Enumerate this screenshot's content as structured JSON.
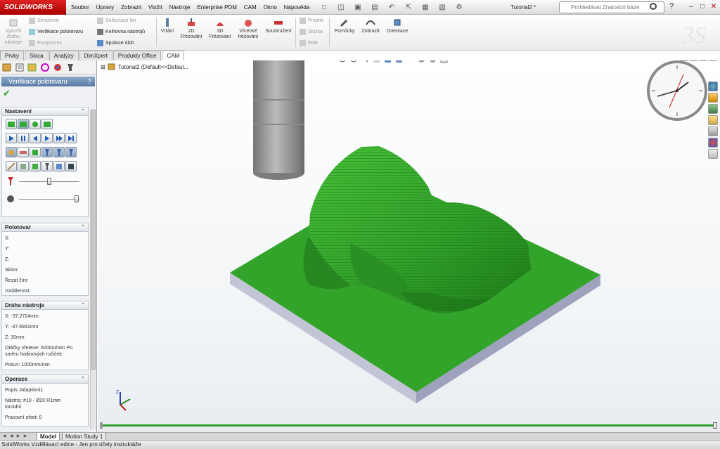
{
  "titlebar": {
    "app_logo": "SOLIDWORKS",
    "menus": [
      "Soubor",
      "Úpravy",
      "Zobrazit",
      "Vložit",
      "Nástroje",
      "Enterprise PDM",
      "CAM",
      "Okno",
      "Nápověda"
    ],
    "document_title": "Tutorial2 *",
    "search_placeholder": "Prohledávat Znalostní báze",
    "help": "?"
  },
  "command_manager": {
    "toolpath_button": "Vytvořit dráhu nástroje",
    "simulate": "Simulovat",
    "verify_stock": "Verifikace polotovaru",
    "postprocess": "Postproces",
    "setup_sheet": "Seřizovací list",
    "tool_library": "Knihovna nástrojů",
    "job_manager": "Správce úloh",
    "drilling": "Vrtání",
    "milling_2d": "2D Frézování",
    "milling_3d": "3D Frézování",
    "multiaxis": "Víceosé frézování",
    "turning": "Soustružení",
    "project": "Projekt",
    "folder": "Složka",
    "field": "Pole",
    "helpers": "Pomůcky",
    "display": "Zobrazit",
    "orientation": "Orientace"
  },
  "tabs": [
    "Prvky",
    "Skica",
    "Analýzy",
    "DimXpert",
    "Produkty Office",
    "CAM"
  ],
  "active_tab": "CAM",
  "property_manager": {
    "title": "Verifikace polotovaru",
    "help": "?",
    "settings": {
      "label": "Nastavení"
    },
    "stock": {
      "label": "Polotovar",
      "rows": [
        "X:",
        "Y:",
        "Z:",
        "Sklon:",
        "Řezat čím:",
        "Vzdálenost:"
      ]
    },
    "toolpath": {
      "label": "Dráha nástroje",
      "x": "X: -37.2724mm",
      "y": "Y: -37.6931mm",
      "z": "Z: 10mm",
      "spindle_1": "Otáčky vřetene: 5000ot/min Po",
      "spindle_2": "směru hodinových ručiček",
      "feed": "Posuv: 1000mm/min"
    },
    "operation": {
      "label": "Operace",
      "description": "Popis: Adaptivní1",
      "tool_1": "Nástroj: #10 - Ø20 R1mm",
      "tool_2": "toroidní",
      "work_offset": "Pracovní ofset: 0"
    }
  },
  "feature_tree": {
    "root": "Tutorial2  (Default<<Defaul..."
  },
  "bottom_tabs": [
    "Model",
    "Motion Study 1"
  ],
  "active_bottom_tab": "Model",
  "status": "SolidWorks Vzdělávací edice - Jen pro účely instruktáže",
  "colors": {
    "part_green": "#2f9e28",
    "stock_gray": "#b8bcd0",
    "accent_red": "#c41a1a",
    "pm_header": "#587ba4"
  },
  "icons": [
    "search-icon",
    "help-icon",
    "clock-icon",
    "triad-icon",
    "check-icon"
  ]
}
